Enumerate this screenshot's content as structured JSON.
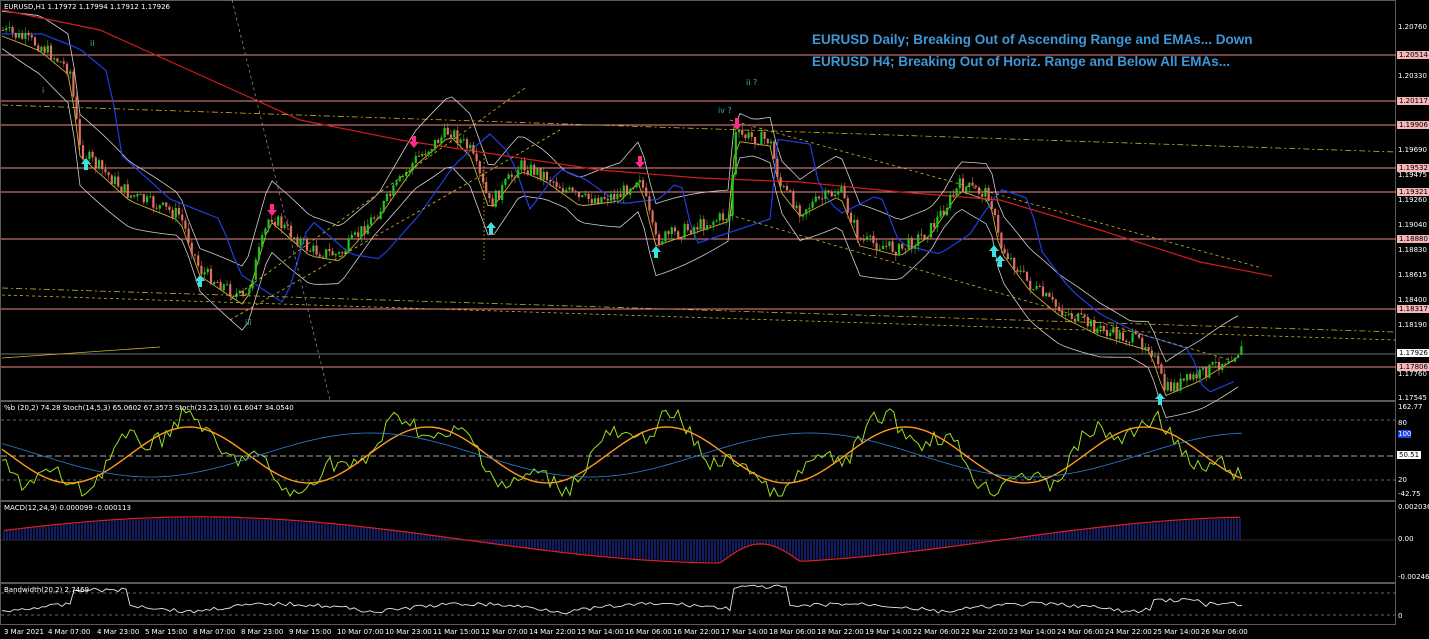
{
  "chart_header": {
    "symbol_line": "EURUSD,H1  1.17972 1.17994 1.17912 1.17926"
  },
  "titles": [
    "EURUSD Daily; Breaking Out of Ascending Range and EMAs... Down",
    "EURUSD H4; Breaking Out of Horiz. Range and Below All EMAs..."
  ],
  "price_axis": {
    "ticks": [
      "1.20760",
      "1.20330",
      "1.19690",
      "1.19475",
      "1.19260",
      "1.19040",
      "1.18830",
      "1.18615",
      "1.18400",
      "1.18190",
      "1.17760",
      "1.17545"
    ],
    "levels": [
      "1.20514",
      "1.20117",
      "1.19906",
      "1.19532",
      "1.19321",
      "1.18880",
      "1.18317",
      "1.17806"
    ],
    "current_price": "1.17926"
  },
  "wave_labels": [
    "ii",
    "i",
    "iii",
    "iv ?",
    "ii ?"
  ],
  "indicators": {
    "stoch_label": "%b (20,2) 74.28  Stoch(14,5,3) 65.0602 67.3573  Stoch(23,23,10) 61.6047 34.0540",
    "stoch_ticks": [
      "162.77",
      "80",
      "100",
      "50.51",
      "20",
      "-42.75"
    ],
    "macd_label": "MACD(12,24,9) 0.000099 -0.000113",
    "macd_ticks": [
      "0.002036",
      "0.00",
      "-0.002462"
    ],
    "bandwidth_label": "Bandwidth(20,2) 2.7469",
    "bandwidth_ticks": [
      "0"
    ]
  },
  "time_axis": [
    "3 Mar 2021",
    "4 Mar 07:00",
    "4 Mar 23:00",
    "5 Mar 15:00",
    "8 Mar 07:00",
    "8 Mar 23:00",
    "9 Mar 15:00",
    "10 Mar 07:00",
    "10 Mar 23:00",
    "11 Mar 15:00",
    "12 Mar 07:00",
    "14 Mar 22:00",
    "15 Mar 14:00",
    "16 Mar 06:00",
    "16 Mar 22:00",
    "17 Mar 14:00",
    "18 Mar 06:00",
    "18 Mar 22:00",
    "19 Mar 14:00",
    "22 Mar 06:00",
    "22 Mar 22:00",
    "23 Mar 14:00",
    "24 Mar 06:00",
    "24 Mar 22:00",
    "25 Mar 14:00",
    "26 Mar 06:00"
  ],
  "colors": {
    "bull": "#22c41a",
    "bear": "#e07060",
    "ema_red": "#d21c1c",
    "ema_blue": "#1f3fe0",
    "band": "#cfcfcf",
    "level": "#f08a8a",
    "title": "#3f96d8",
    "arrow_up": "#40e0e0",
    "arrow_down": "#ff2a8a"
  }
}
